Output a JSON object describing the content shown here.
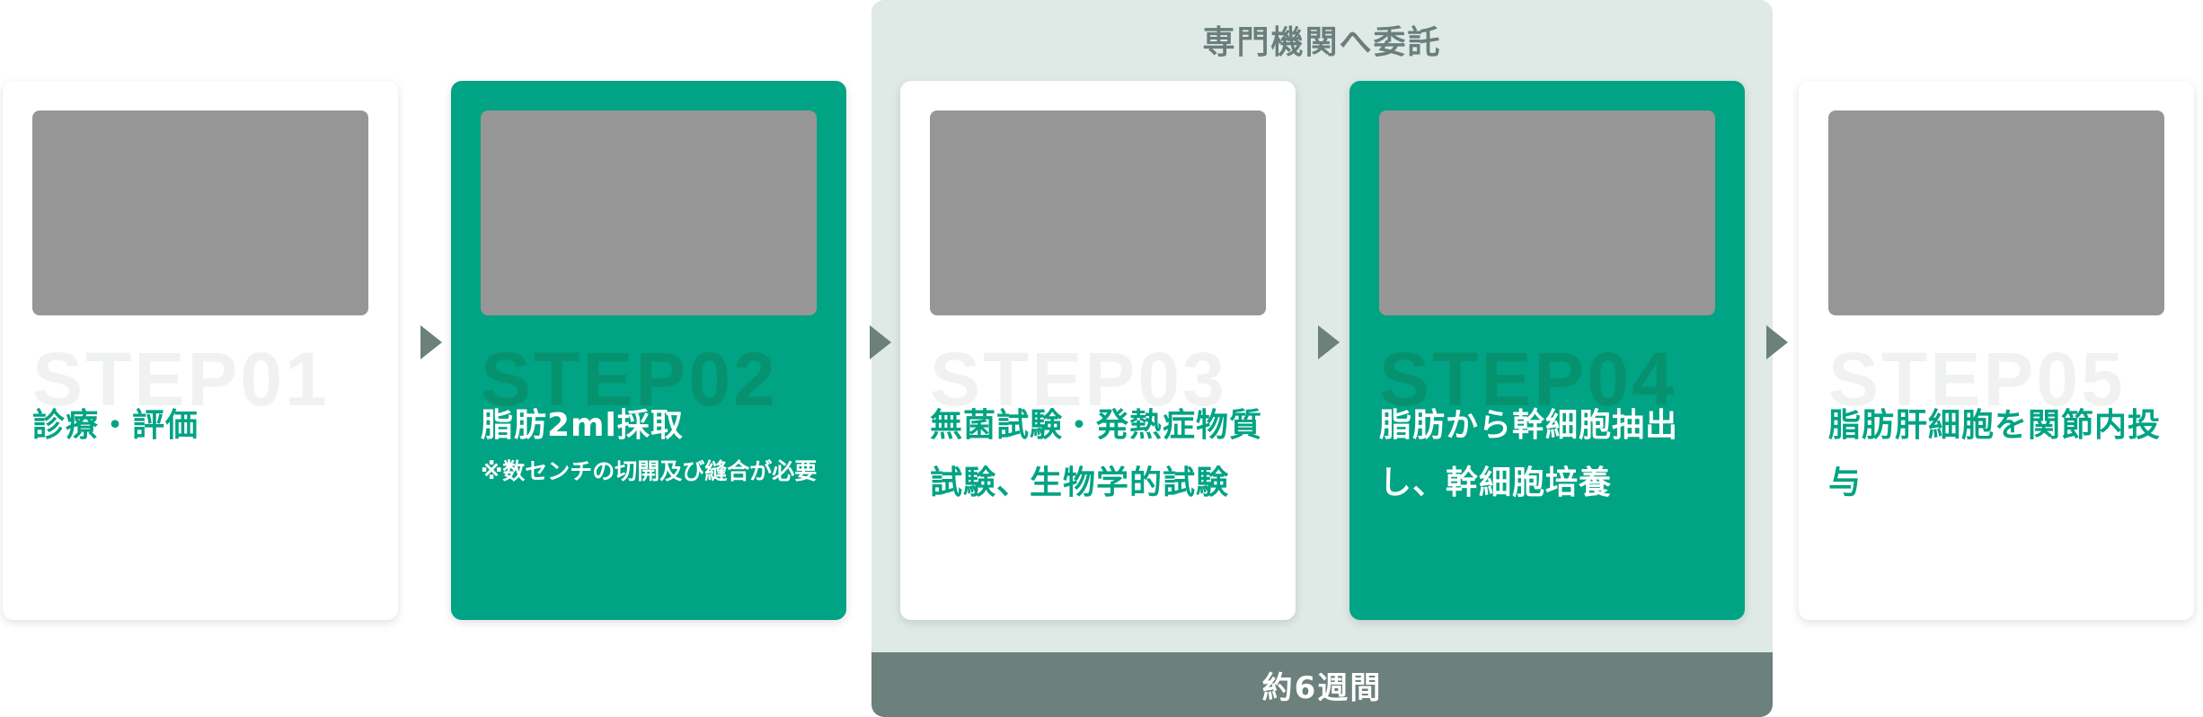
{
  "group": {
    "title": "専門機関へ委託",
    "duration": "約6週間"
  },
  "steps": [
    {
      "number": "STEP01",
      "title": "診療・評価",
      "note": ""
    },
    {
      "number": "STEP02",
      "title": "脂肪2ml採取",
      "note": "※数センチの切開及び縫合が必要"
    },
    {
      "number": "STEP03",
      "title": "無菌試験・発熱症物質試験、生物学的試験",
      "note": ""
    },
    {
      "number": "STEP04",
      "title": "脂肪から幹細胞抽出し、幹細胞培養",
      "note": ""
    },
    {
      "number": "STEP05",
      "title": "脂肪肝細胞を関節内投与",
      "note": ""
    }
  ],
  "colors": {
    "accent_green": "#00a383",
    "group_bg": "#dfe9e6",
    "group_footer": "#6c807c",
    "placeholder_gray": "#969696"
  }
}
